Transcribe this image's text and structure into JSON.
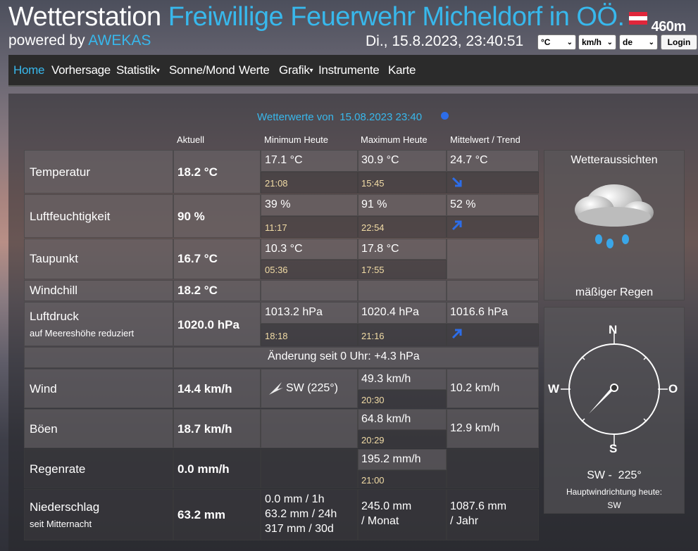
{
  "header": {
    "title_prefix": "Wetterstation",
    "title_station": "Freiwillige Feuerwehr Micheldorf in OÖ.",
    "altitude": "460m",
    "powered_by": "powered by",
    "powered_brand": "AWEKAS",
    "datetime": "Di., 15.8.2023, 23:40:51",
    "unit_temp": "°C",
    "unit_wind": "km/h",
    "language": "de",
    "login_label": "Login"
  },
  "nav": {
    "home": "Home",
    "forecast": "Vorhersage",
    "stats": "Statistik",
    "sun_moon": "Sonne/Mond",
    "values": "Werte",
    "graphs": "Grafik",
    "instruments": "Instrumente",
    "map": "Karte"
  },
  "summary": {
    "title": "Wetterwerte von",
    "date": "15.08.2023 23:40"
  },
  "columns": {
    "current": "Aktuell",
    "min": "Minimum Heute",
    "max": "Maximum Heute",
    "avg": "Mittelwert / Trend"
  },
  "rows": {
    "temperature": {
      "label": "Temperatur",
      "current": "18.2 °C",
      "min": "17.1 °C",
      "min_time": "21:08",
      "max": "30.9 °C",
      "max_time": "15:45",
      "avg": "24.7 °C",
      "trend": "down"
    },
    "humidity": {
      "label": "Luftfeuchtigkeit",
      "current": "90 %",
      "min": "39 %",
      "min_time": "11:17",
      "max": "91 %",
      "max_time": "22:54",
      "avg": "52 %",
      "trend": "up"
    },
    "dewpoint": {
      "label": "Taupunkt",
      "current": "16.7 °C",
      "min": "10.3 °C",
      "min_time": "05:36",
      "max": "17.8 °C",
      "max_time": "17:55"
    },
    "windchill": {
      "label": "Windchill",
      "current": "18.2 °C"
    },
    "pressure": {
      "label": "Luftdruck",
      "sublabel": "auf Meereshöhe reduziert",
      "current": "1020.0 hPa",
      "min": "1013.2 hPa",
      "min_time": "18:18",
      "max": "1020.4 hPa",
      "max_time": "21:16",
      "avg": "1016.6 hPa",
      "trend": "up",
      "change": "Änderung seit 0 Uhr: +4.3 hPa"
    },
    "wind": {
      "label": "Wind",
      "current": "14.4 km/h",
      "direction": "SW (225°)",
      "max": "49.3 km/h",
      "max_time": "20:30",
      "avg": "10.2 km/h"
    },
    "gusts": {
      "label": "Böen",
      "current": "18.7 km/h",
      "max": "64.8 km/h",
      "max_time": "20:29",
      "avg": "12.9 km/h"
    },
    "rainrate": {
      "label": "Regenrate",
      "current": "0.0 mm/h",
      "max": "195.2 mm/h",
      "max_time": "21:00"
    },
    "precip": {
      "label": "Niederschlag",
      "sublabel": "seit Mitternacht",
      "current": "63.2 mm",
      "col1_line1": "0.0 mm / 1h",
      "col1_line2": "63.2 mm / 24h",
      "col1_line3": "317 mm / 30d",
      "month_value": "245.0 mm",
      "month_label": "/ Monat",
      "year_value": "1087.6 mm",
      "year_label": "/ Jahr"
    }
  },
  "forecast": {
    "title": "Wetteraussichten",
    "condition": "mäßiger Regen",
    "icon": "rain-cloud-icon"
  },
  "compass": {
    "north": "N",
    "east": "O",
    "south": "S",
    "west": "W",
    "reading": "SW -  225°",
    "main_dir_label": "Hauptwindrichtung heute:",
    "main_dir_value": "SW",
    "direction_deg": 225
  },
  "colors": {
    "accent": "#38b8ec",
    "time": "#f2dca6",
    "trend_arrow": "#2d6de8"
  }
}
